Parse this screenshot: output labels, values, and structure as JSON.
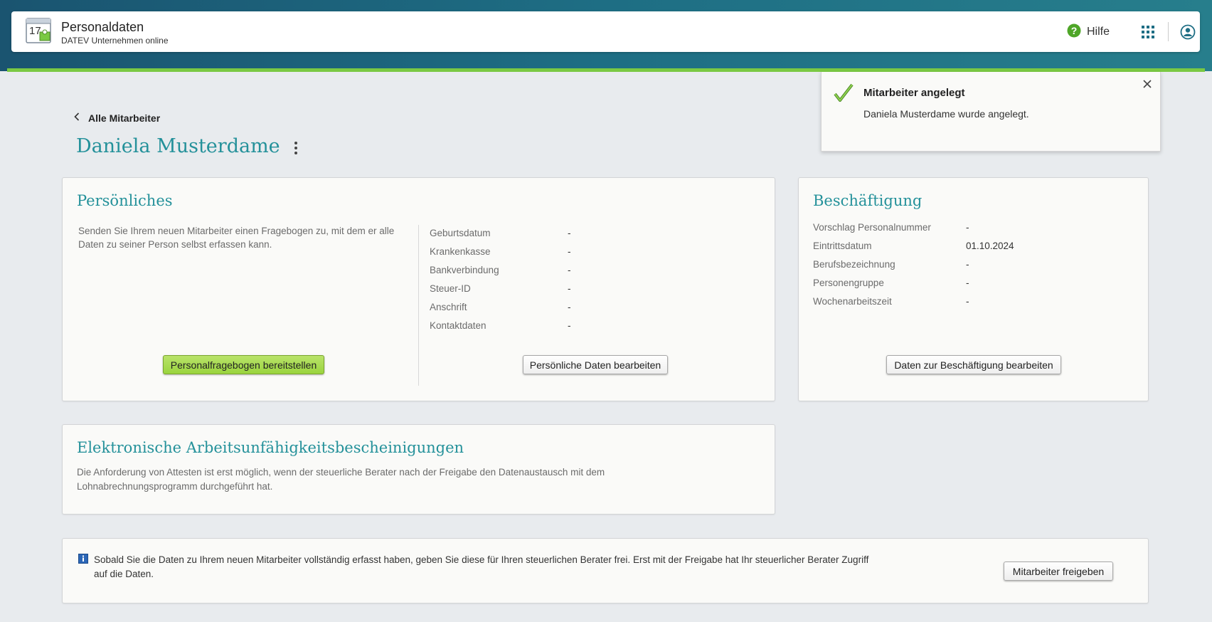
{
  "header": {
    "app_title": "Personaldaten",
    "app_subtitle": "DATEV Unternehmen online",
    "app_icon_day": "17",
    "help_label": "Hilfe",
    "accent_color": "#24919a",
    "brand_green": "#7ac943"
  },
  "nav": {
    "back_label": "Alle Mitarbeiter"
  },
  "page": {
    "title": "Daniela Musterdame"
  },
  "toast": {
    "title": "Mitarbeiter angelegt",
    "message": "Daniela Musterdame wurde angelegt."
  },
  "personal": {
    "title": "Persönliches",
    "description": "Senden Sie Ihrem neuen Mitarbeiter einen Fragebogen zu, mit dem er alle Daten zu seiner Person selbst erfassen kann.",
    "questionnaire_button": "Personalfragebogen bereitstellen",
    "edit_button": "Persönliche Daten bearbeiten",
    "fields": [
      {
        "label": "Geburtsdatum",
        "value": "-"
      },
      {
        "label": "Krankenkasse",
        "value": "-"
      },
      {
        "label": "Bankverbindung",
        "value": "-"
      },
      {
        "label": "Steuer-ID",
        "value": "-"
      },
      {
        "label": "Anschrift",
        "value": "-"
      },
      {
        "label": "Kontaktdaten",
        "value": "-"
      }
    ]
  },
  "employment": {
    "title": "Beschäftigung",
    "edit_button": "Daten zur Beschäftigung bearbeiten",
    "fields": [
      {
        "label": "Vorschlag Personalnummer",
        "value": "-"
      },
      {
        "label": "Eintrittsdatum",
        "value": "01.10.2024"
      },
      {
        "label": "Berufsbezeichnung",
        "value": "-"
      },
      {
        "label": "Personengruppe",
        "value": "-"
      },
      {
        "label": "Wochenarbeitszeit",
        "value": "-"
      }
    ]
  },
  "eau": {
    "title": "Elektronische Arbeitsunfähigkeitsbescheinigungen",
    "line1": "Die Anforderung von Attesten ist erst möglich, wenn der steuerliche Berater nach der Freigabe den Datenaustausch mit dem",
    "line2": "Lohnabrechnungsprogramm durchgeführt hat."
  },
  "release": {
    "line1": "Sobald Sie die Daten zu Ihrem neuen Mitarbeiter vollständig erfasst haben, geben Sie diese für Ihren steuerlichen Berater frei. Erst mit der Freigabe hat Ihr steuerlicher Berater Zugriff",
    "line2": "auf die Daten.",
    "button": "Mitarbeiter freigeben"
  }
}
